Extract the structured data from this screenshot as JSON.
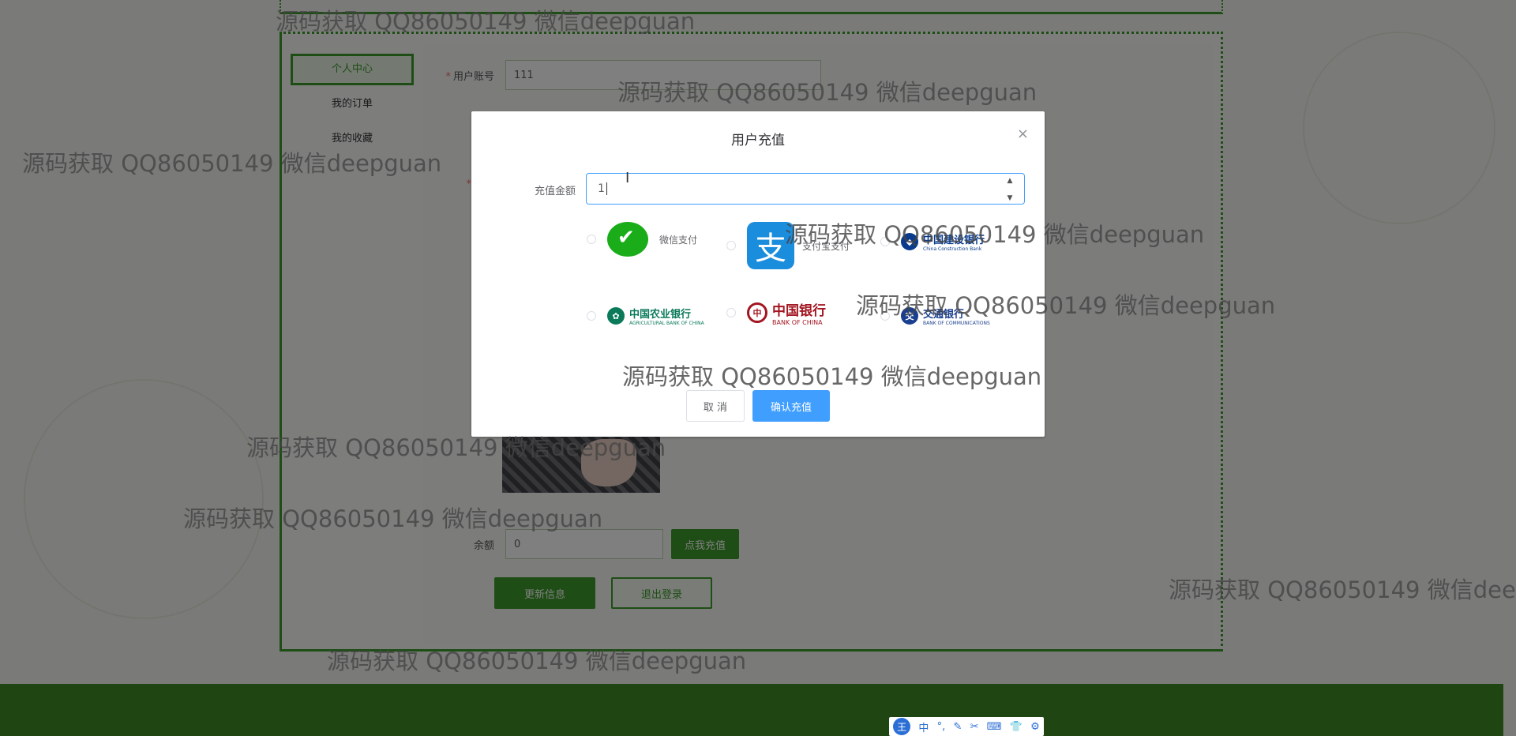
{
  "sidebar": {
    "items": [
      {
        "label": "个人中心",
        "active": true
      },
      {
        "label": "我的订单"
      },
      {
        "label": "我的收藏"
      }
    ]
  },
  "form": {
    "account_label": "用户账号",
    "account_value": "111",
    "user_label_partial_1": "用户",
    "user_label_partial_2": "用户",
    "balance_label": "余额",
    "balance_value": "0",
    "recharge_button": "点我充值",
    "update_button": "更新信息",
    "logout_button": "退出登录"
  },
  "dialog": {
    "title": "用户充值",
    "close": "×",
    "amount_label": "充值金额",
    "amount_value": "1",
    "payment_options": [
      {
        "name": "wechat",
        "label": "微信支付"
      },
      {
        "name": "alipay",
        "label": "支付宝支付"
      },
      {
        "name": "ccb",
        "label": "中国建设银行",
        "sub": "China Construction Bank"
      },
      {
        "name": "abc",
        "label": "中国农业银行",
        "sub": "AGRICULTURAL BANK OF CHINA"
      },
      {
        "name": "boc",
        "label": "中国银行",
        "sub": "BANK OF CHINA"
      },
      {
        "name": "bocom",
        "label": "交通银行",
        "sub": "BANK OF COMMUNICATIONS"
      }
    ],
    "cancel_button": "取 消",
    "confirm_button": "确认充值"
  },
  "ime_toolbar": {
    "logo": "王",
    "mode": "中"
  },
  "watermark_text": "源码获取 QQ86050149 微信deepguan",
  "watermark_text_cut": "源码获取 QQ86050149 微信dee",
  "colors": {
    "theme_green": "#3c9a2a",
    "primary_blue": "#409eff",
    "footer_green": "#3c8a25"
  }
}
